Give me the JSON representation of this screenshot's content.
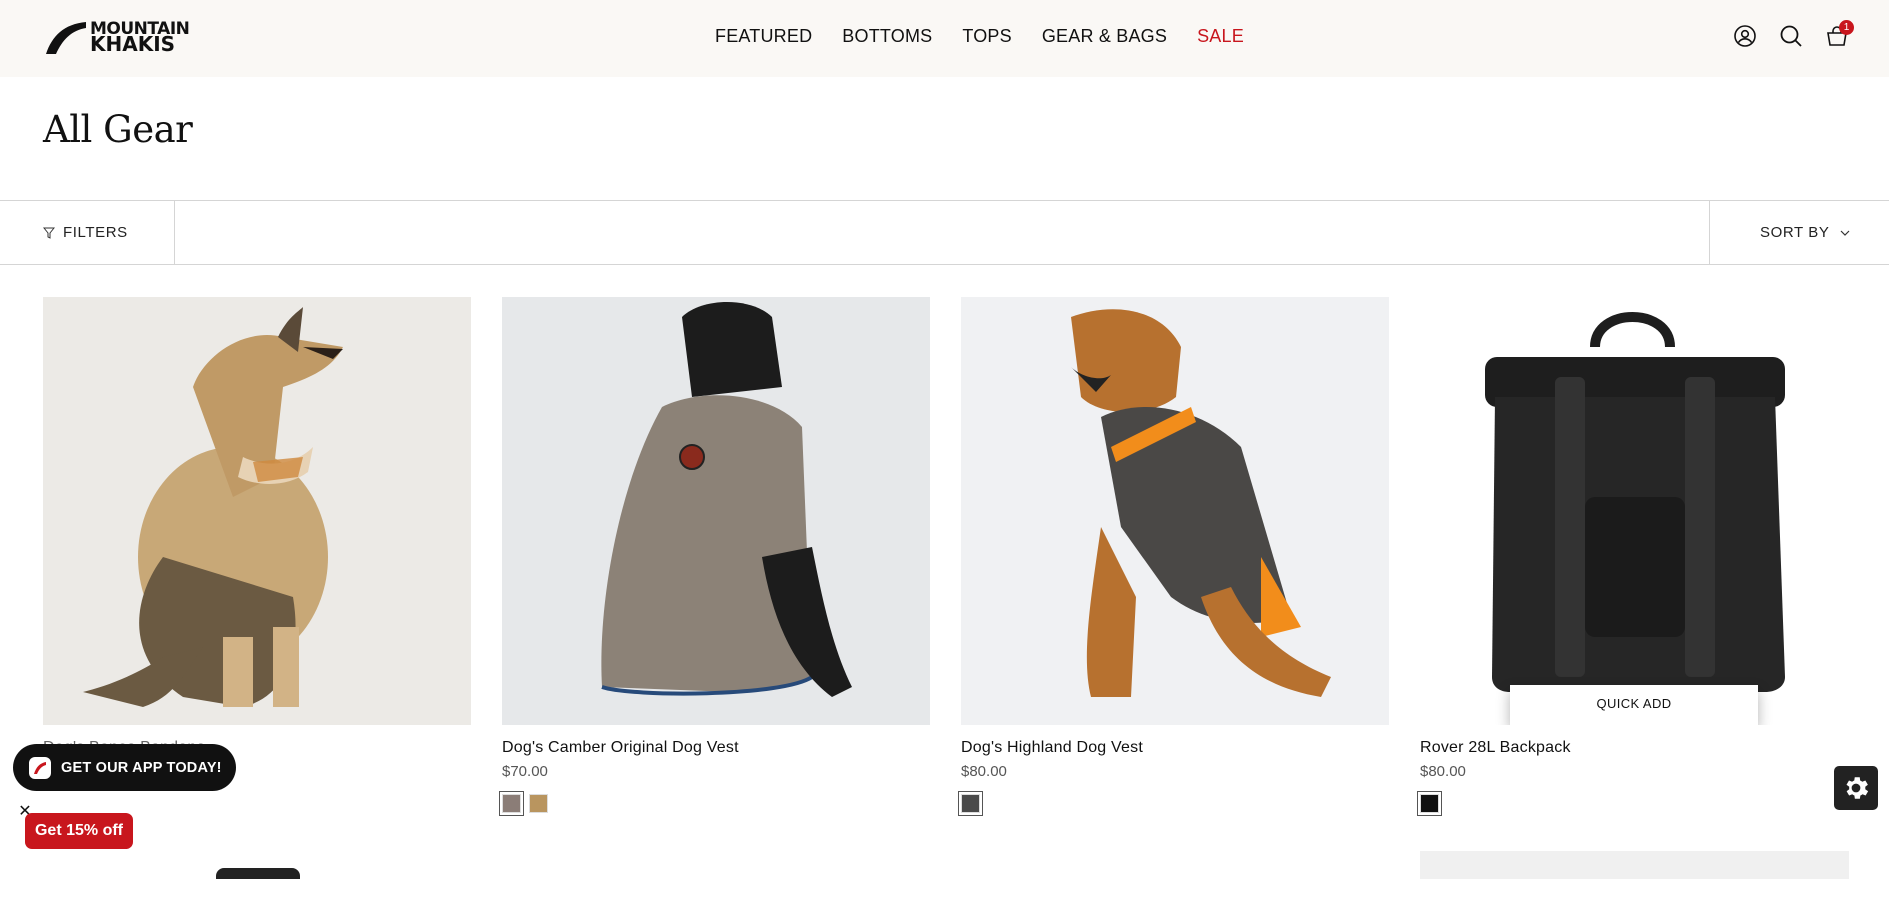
{
  "header": {
    "logo_line1": "MOUNTAIN",
    "logo_line2": "KHAKIS",
    "nav": [
      "FEATURED",
      "BOTTOMS",
      "TOPS",
      "GEAR & BAGS",
      "SALE"
    ],
    "cart_count": "1",
    "icons": [
      "account-icon",
      "search-icon",
      "cart-icon"
    ]
  },
  "page": {
    "title": "All Gear"
  },
  "toolbar": {
    "filters_label": "FILTERS",
    "sort_label": "SORT BY"
  },
  "products": [
    {
      "name": "Dog's Bones Bandana",
      "price": "",
      "swatches": [
        "#e9e6df",
        "#7a7a66",
        "#2a2e3f"
      ]
    },
    {
      "name": "Dog's Camber Original Dog Vest",
      "price": "$70.00",
      "swatches": [
        "#8b7d77",
        "#b9955f"
      ]
    },
    {
      "name": "Dog's Highland Dog Vest",
      "price": "$80.00",
      "swatches": [
        "#4a4a4a"
      ]
    },
    {
      "name": "Rover 28L Backpack",
      "price": "$80.00",
      "swatches": [
        "#111111"
      ],
      "quick_add": "QUICK ADD"
    }
  ],
  "app_banner": {
    "label": "GET OUR APP TODAY!"
  },
  "promo": {
    "label": "Get 15% off",
    "close": "✕"
  },
  "colors": {
    "sale": "#c8161d",
    "header_bg": "#faf8f5",
    "promo_bg": "#c8161d"
  }
}
